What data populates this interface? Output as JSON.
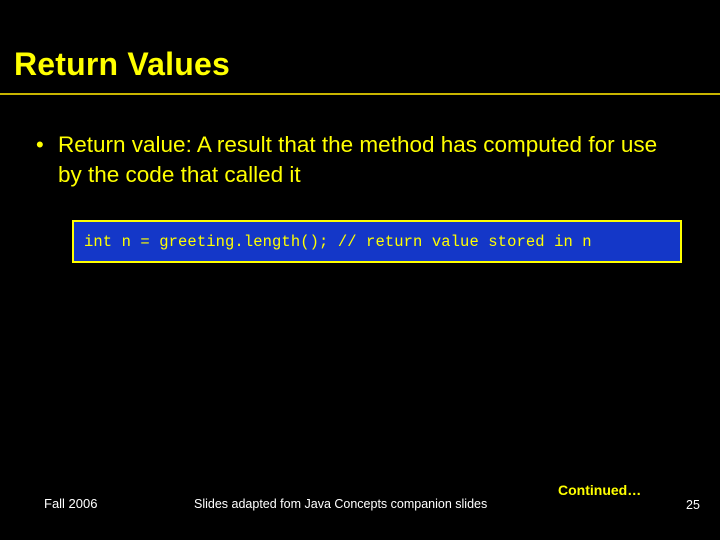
{
  "slide": {
    "title": "Return Values",
    "bullet": {
      "marker": "•",
      "text": "Return value: A result that the method has computed for use by the code that called it"
    },
    "code": "int n = greeting.length(); // return value stored in n",
    "footer": {
      "left": "Fall 2006",
      "center": "Slides adapted fom Java Concepts companion slides",
      "continued": "Continued…",
      "page_number": "25"
    },
    "colors": {
      "background": "#000000",
      "accent": "#ffff00",
      "code_background": "#1437c8",
      "rule": "#c8b400",
      "footer_text": "#ffffff"
    }
  }
}
